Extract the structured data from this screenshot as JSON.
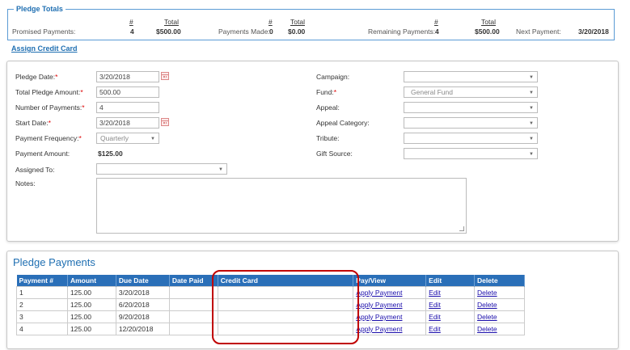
{
  "totals": {
    "legend": "Pledge Totals",
    "hash": "#",
    "total": "Total",
    "promised_label": "Promised Payments:",
    "promised_count": "4",
    "promised_total": "$500.00",
    "made_label": "Payments Made:",
    "made_count": "0",
    "made_total": "$0.00",
    "remaining_label": "Remaining Payments:",
    "remaining_count": "4",
    "remaining_total": "$500.00",
    "next_label": "Next Payment:",
    "next_value": "3/20/2018"
  },
  "assign_link": "Assign Credit Card",
  "form": {
    "pledge_date_label": "Pledge Date:",
    "pledge_date": "3/20/2018",
    "total_amount_label": "Total Pledge Amount:",
    "total_amount": "500.00",
    "num_payments_label": "Number of Payments:",
    "num_payments": "4",
    "start_date_label": "Start Date:",
    "start_date": "3/20/2018",
    "frequency_label": "Payment Frequency:",
    "frequency": "Quarterly",
    "payment_amount_label": "Payment Amount:",
    "payment_amount": "$125.00",
    "assigned_to_label": "Assigned To:",
    "assigned_to": "",
    "notes_label": "Notes:",
    "campaign_label": "Campaign:",
    "campaign": "",
    "fund_label": "Fund:",
    "fund": "General Fund",
    "appeal_label": "Appeal:",
    "appeal": "",
    "appeal_category_label": "Appeal Category:",
    "appeal_category": "",
    "tribute_label": "Tribute:",
    "tribute": "",
    "gift_source_label": "Gift Source:",
    "gift_source": ""
  },
  "payments": {
    "title": "Pledge Payments",
    "columns": [
      "Payment #",
      "Amount",
      "Due Date",
      "Date Paid",
      "Credit Card",
      "Pay/View",
      "Edit",
      "Delete"
    ],
    "rows": [
      {
        "num": "1",
        "amount": "125.00",
        "due": "3/20/2018",
        "paid": "",
        "card": "",
        "pay": "Apply Payment",
        "edit": "Edit",
        "delete": "Delete"
      },
      {
        "num": "2",
        "amount": "125.00",
        "due": "6/20/2018",
        "paid": "",
        "card": "",
        "pay": "Apply Payment",
        "edit": "Edit",
        "delete": "Delete"
      },
      {
        "num": "3",
        "amount": "125.00",
        "due": "9/20/2018",
        "paid": "",
        "card": "",
        "pay": "Apply Payment",
        "edit": "Edit",
        "delete": "Delete"
      },
      {
        "num": "4",
        "amount": "125.00",
        "due": "12/20/2018",
        "paid": "",
        "card": "",
        "pay": "Apply Payment",
        "edit": "Edit",
        "delete": "Delete"
      }
    ]
  },
  "colors": {
    "accent": "#1f6fb2",
    "table_header": "#2a6fb8",
    "required": "#dd0000",
    "highlight": "#c00000"
  }
}
